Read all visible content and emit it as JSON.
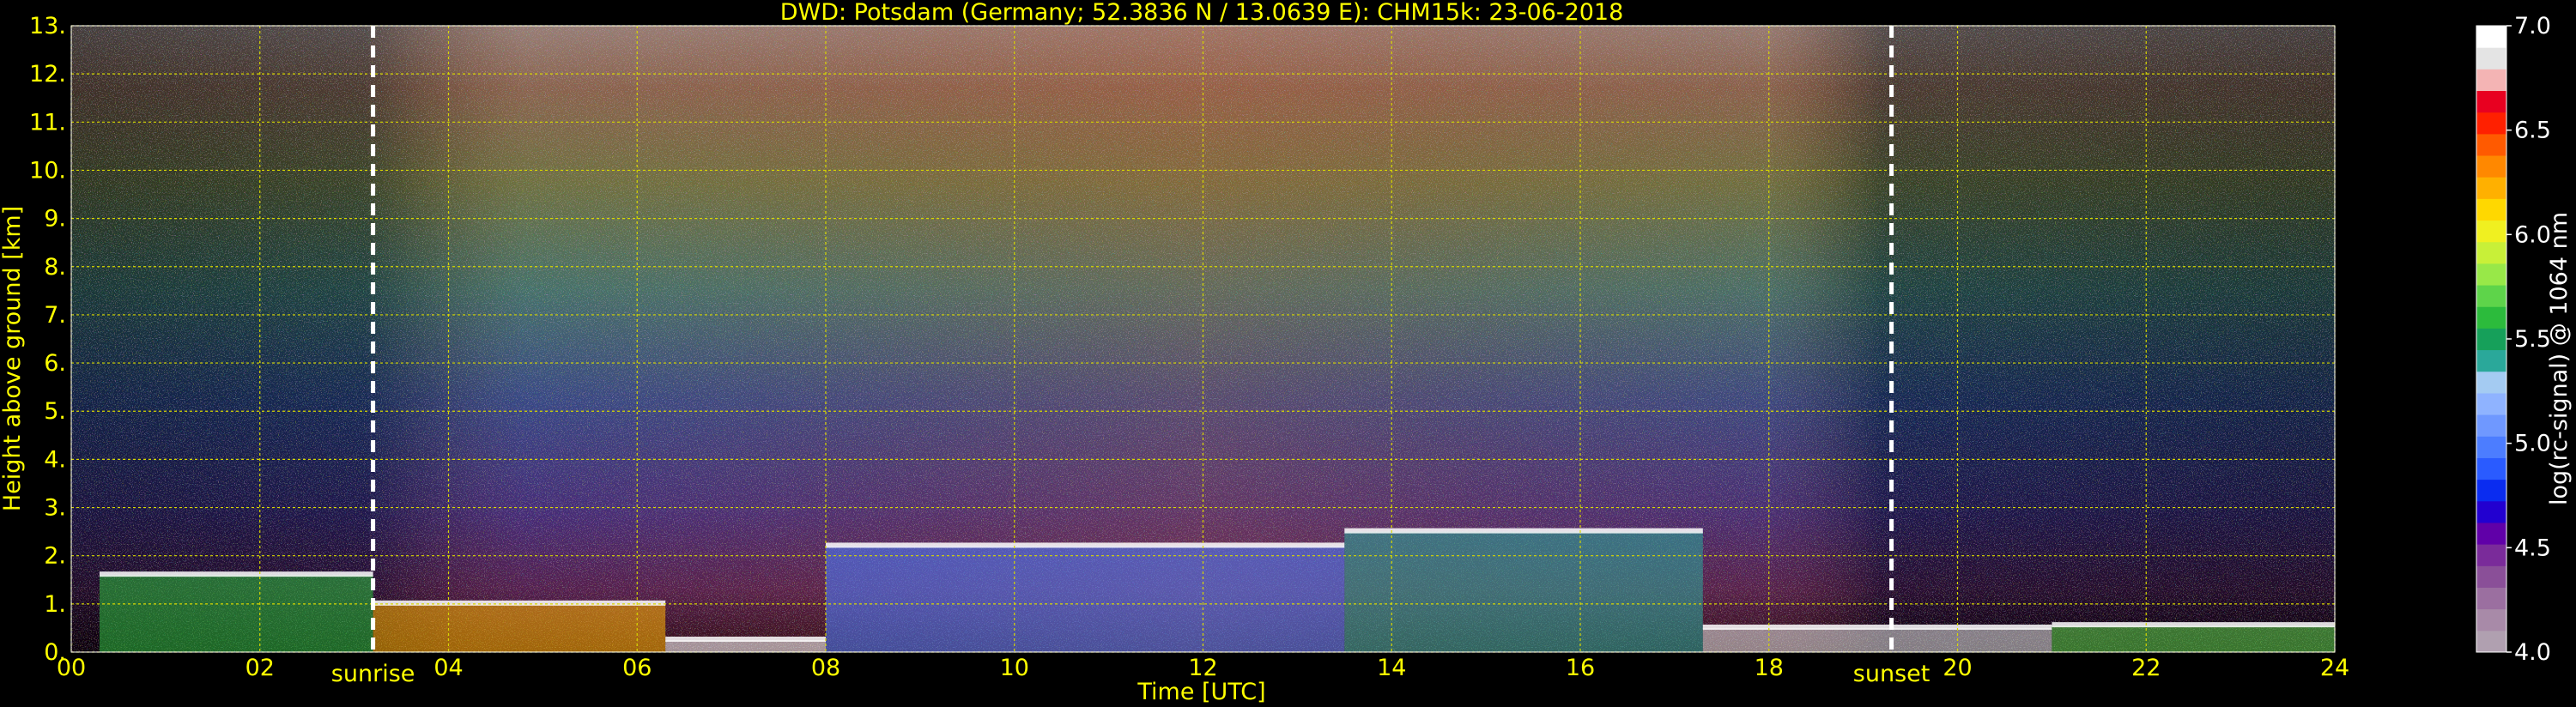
{
  "chart_data": {
    "type": "heatmap",
    "title": "DWD: Potsdam (Germany; 52.3836 N / 13.0639 E):    CHM15k: 23-06-2018",
    "xlabel": "Time [UTC]",
    "ylabel": "Height above ground [km]",
    "xlim": [
      0,
      24
    ],
    "ylim": [
      0,
      13
    ],
    "x_ticks": [
      "00",
      "02",
      "04",
      "06",
      "08",
      "10",
      "12",
      "14",
      "16",
      "18",
      "20",
      "22",
      "24"
    ],
    "y_ticks": [
      "0.",
      "1.",
      "2.",
      "3.",
      "4.",
      "5.",
      "6.",
      "7.",
      "8.",
      "9.",
      "10.",
      "11.",
      "12.",
      "13."
    ],
    "grid": true,
    "annotations": [
      {
        "label": "sunrise",
        "x": 3.2
      },
      {
        "label": "sunset",
        "x": 19.3
      }
    ],
    "colorbar": {
      "label": "log(rc-signal) @ 1064 nm",
      "range": [
        4.0,
        7.0
      ],
      "ticks": [
        "4.0",
        "4.5",
        "5.0",
        "5.5",
        "6.0",
        "6.5",
        "7.0"
      ],
      "colors": [
        "#b0a0b0",
        "#a88aa8",
        "#9b6fa0",
        "#8a4f98",
        "#7a2b9a",
        "#6000a8",
        "#2200d0",
        "#0a2cf0",
        "#2a5bff",
        "#4c7dff",
        "#6f98ff",
        "#8fb3ff",
        "#a4cbf2",
        "#2aa89a",
        "#16a05a",
        "#2cbb3c",
        "#5ed44a",
        "#98e848",
        "#c8f038",
        "#f0f020",
        "#ffd800",
        "#ffb000",
        "#ff8800",
        "#ff5a00",
        "#ff2000",
        "#e80020",
        "#f4b4b4",
        "#e4e4e4",
        "#ffffff"
      ]
    }
  }
}
